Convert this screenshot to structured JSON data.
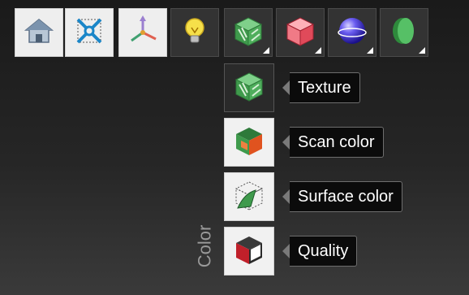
{
  "toolbar": {
    "buttons": [
      {
        "name": "home-icon"
      },
      {
        "name": "fit-view-icon"
      },
      {
        "name": "axes-icon"
      },
      {
        "name": "light-bulb-icon"
      },
      {
        "name": "texture-cube-icon"
      },
      {
        "name": "red-cube-icon"
      },
      {
        "name": "blue-sphere-icon"
      },
      {
        "name": "green-disk-icon"
      }
    ]
  },
  "color_menu": {
    "section_label": "Color",
    "items": [
      {
        "label": "Texture",
        "icon": "texture-cube-icon"
      },
      {
        "label": "Scan color",
        "icon": "scan-color-cube-icon"
      },
      {
        "label": "Surface color",
        "icon": "surface-color-cube-icon"
      },
      {
        "label": "Quality",
        "icon": "quality-cube-icon"
      }
    ]
  },
  "colors": {
    "tooltip_bg": "#0b0b0b",
    "tooltip_text": "#ffffff",
    "label_gray": "#9a9a9a",
    "texture_green": "#3f9a4c",
    "scan_orange": "#e0531f",
    "quality_red": "#c0202a",
    "sphere_blue": "#3a2fd4"
  }
}
